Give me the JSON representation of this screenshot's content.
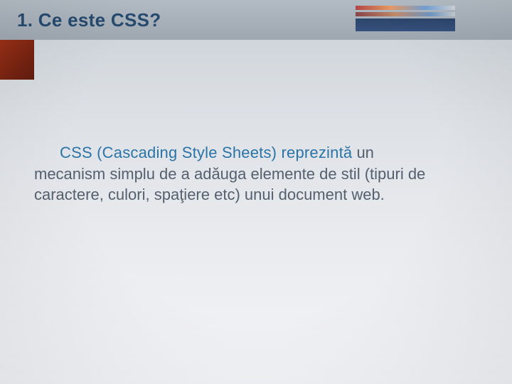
{
  "title": "1. Ce este CSS?",
  "paragraph": {
    "lead": "CSS (Cascading Style Sheets) reprezintă",
    "rest": " un mecanism simplu de a adăuga elemente de stil (tipuri de caractere, culori, spaţiere etc) unui document web."
  }
}
